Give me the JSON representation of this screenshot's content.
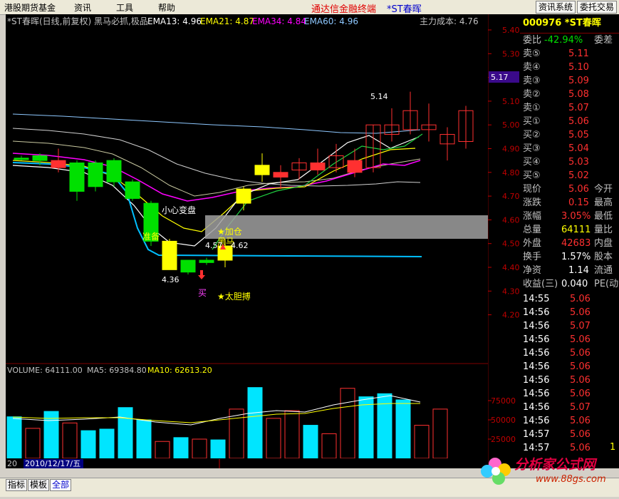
{
  "menu": [
    "港股期货基金",
    "资讯",
    "工具",
    "帮助"
  ],
  "brand": "通达信金融终端",
  "stock_link": "*ST春晖",
  "top_buttons": [
    "资讯系统",
    "委托交易"
  ],
  "chart_header": {
    "name": "*ST春晖(日线,前复权) 黑马必抓,极品",
    "ema13": "EMA13: 4.96",
    "ema21": "EMA21: 4.87",
    "ema34": "EMA34: 4.84",
    "ema60": "EMA60: 4.96",
    "cost": "主力成本: 4.76"
  },
  "annotations": {
    "high": "5.14",
    "low": "4.36",
    "careful": "小心变盘",
    "prepare": "准备",
    "add": "★加仓",
    "dark_horse": "黑马",
    "buy": "买",
    "bold": "★太胆搏",
    "p457": "4.57",
    "p462": "4.62"
  },
  "price_axis": [
    "5.40",
    "5.30",
    "5.20",
    "5.10",
    "5.00",
    "4.90",
    "4.80",
    "4.70",
    "4.60",
    "4.50",
    "4.40",
    "4.30",
    "4.20"
  ],
  "current_price_tag": "5.17",
  "volume_header": {
    "volume": "VOLUME: 64111.00",
    "ma5": "MA5: 69384.80",
    "ma10": "MA10: 62613.20"
  },
  "volume_axis": [
    "75000",
    "50000",
    "25000"
  ],
  "date_label": "2010/12/17/五",
  "date_prefix": "20",
  "quote": {
    "code": "000976 *ST春晖",
    "weibi_label": "委比",
    "weibi_value": "-42.94%",
    "weicha_label": "委差",
    "asks": [
      {
        "label": "卖⑤",
        "price": "5.11"
      },
      {
        "label": "卖④",
        "price": "5.10"
      },
      {
        "label": "卖③",
        "price": "5.09"
      },
      {
        "label": "卖②",
        "price": "5.08"
      },
      {
        "label": "卖①",
        "price": "5.07"
      }
    ],
    "bids": [
      {
        "label": "买①",
        "price": "5.06"
      },
      {
        "label": "买②",
        "price": "5.05"
      },
      {
        "label": "买③",
        "price": "5.04"
      },
      {
        "label": "买④",
        "price": "5.03"
      },
      {
        "label": "买⑤",
        "price": "5.02"
      }
    ],
    "stats": [
      {
        "label": "现价",
        "value": "5.06",
        "color": "red",
        "label2": "今开"
      },
      {
        "label": "涨跌",
        "value": "0.15",
        "color": "red",
        "label2": "最高"
      },
      {
        "label": "涨幅",
        "value": "3.05%",
        "color": "red",
        "label2": "最低"
      },
      {
        "label": "总量",
        "value": "64111",
        "color": "yellow",
        "label2": "量比"
      },
      {
        "label": "外盘",
        "value": "42683",
        "color": "red",
        "label2": "内盘"
      },
      {
        "label": "换手",
        "value": "1.57%",
        "color": "white",
        "label2": "股本"
      },
      {
        "label": "净资",
        "value": "1.14",
        "color": "white",
        "label2": "流通"
      },
      {
        "label": "收益(三)",
        "value": "0.040",
        "color": "white",
        "label2": "PE(动"
      }
    ],
    "ticks": [
      {
        "time": "14:55",
        "price": "5.06",
        "color": "red"
      },
      {
        "time": "14:56",
        "price": "5.06",
        "color": "red"
      },
      {
        "time": "14:56",
        "price": "5.07",
        "color": "red"
      },
      {
        "time": "14:56",
        "price": "5.06",
        "color": "red"
      },
      {
        "time": "14:56",
        "price": "5.06",
        "color": "red"
      },
      {
        "time": "14:56",
        "price": "5.06",
        "color": "red"
      },
      {
        "time": "14:56",
        "price": "5.06",
        "color": "red"
      },
      {
        "time": "14:56",
        "price": "5.06",
        "color": "red"
      },
      {
        "time": "14:56",
        "price": "5.07",
        "color": "red"
      },
      {
        "time": "14:56",
        "price": "5.06",
        "color": "red"
      },
      {
        "time": "14:57",
        "price": "5.06",
        "color": "red"
      },
      {
        "time": "14:57",
        "price": "5.06",
        "color": "red"
      }
    ],
    "last_tick_vol": "1"
  },
  "bottom_tabs": [
    "指标",
    "模板",
    "全部"
  ],
  "watermark": {
    "name": "分析家公式网",
    "url": "www.88gs.com"
  },
  "colors": {
    "up": "#ff3030",
    "down": "#00e000",
    "ema13": "#ffffff",
    "ema21": "#ffff00",
    "ema34": "#ff00ff",
    "ema60": "#8ec8ff",
    "volume_up": "#ff3030",
    "volume_down": "#00e5ff"
  }
}
